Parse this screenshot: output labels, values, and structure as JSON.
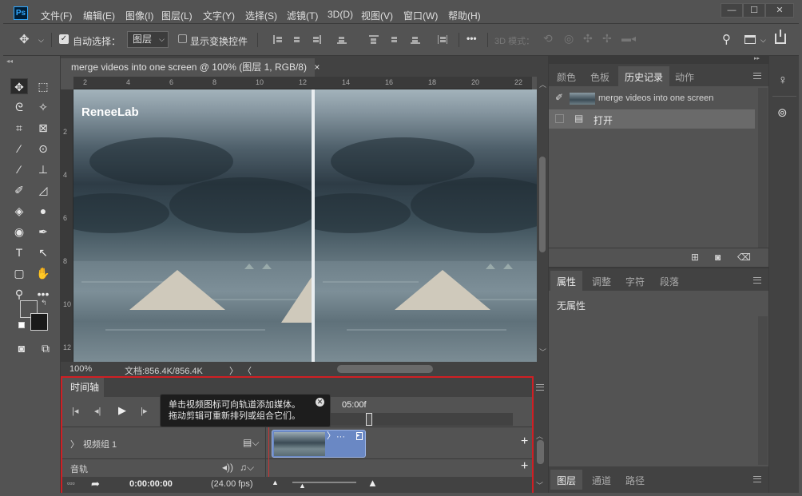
{
  "app": {
    "logo": "Ps"
  },
  "menu": [
    "文件(F)",
    "编辑(E)",
    "图像(I)",
    "图层(L)",
    "文字(Y)",
    "选择(S)",
    "滤镜(T)",
    "3D(D)",
    "视图(V)",
    "窗口(W)",
    "帮助(H)"
  ],
  "window_controls": {
    "minimize": "—",
    "maximize": "☐",
    "close": "✕"
  },
  "options_bar": {
    "auto_select_label": "自动选择：",
    "auto_select_checked": true,
    "auto_select_target": "图层",
    "show_transform_label": "显示变换控件",
    "show_transform_checked": false,
    "more": "•••",
    "mode_3d_label": "3D 模式："
  },
  "document": {
    "tab_title": "merge videos into one screen @ 100% (图层 1, RGB/8)",
    "tab_close": "×",
    "watermark": "ReneeLab",
    "ruler_top": [
      "2",
      "4",
      "6",
      "8",
      "10",
      "12",
      "14",
      "16",
      "18",
      "20",
      "22"
    ],
    "ruler_left": [
      "2",
      "4",
      "6",
      "8",
      "10",
      "12"
    ],
    "zoom": "100%",
    "doc_size": "文档:856.4K/856.4K"
  },
  "timeline": {
    "title": "时间轴",
    "time_marker": "05:00f",
    "video_group_label": "视频组 1",
    "audio_track_label": "音轨",
    "current_time": "0:00:00:00",
    "fps": "(24.00 fps)",
    "tooltip_line1": "单击视频图标可向轨道添加媒体。",
    "tooltip_line2": "拖动剪辑可重新排列或组合它们。"
  },
  "panels": {
    "history_tabs": [
      "颜色",
      "色板",
      "历史记录",
      "动作"
    ],
    "history_active_tab": "历史记录",
    "history_snapshot": "merge videos into one screen",
    "history_items": [
      "打开"
    ],
    "props_tabs": [
      "属性",
      "调整",
      "字符",
      "段落"
    ],
    "props_active_tab": "属性",
    "props_content": "无属性",
    "layers_tabs": [
      "图层",
      "通道",
      "路径"
    ],
    "layers_active_tab": "图层"
  },
  "colors": {
    "accent_border": "#d01f24",
    "clip": "#6a88c4",
    "panel_bg": "#535353",
    "dark_bg": "#424242"
  }
}
